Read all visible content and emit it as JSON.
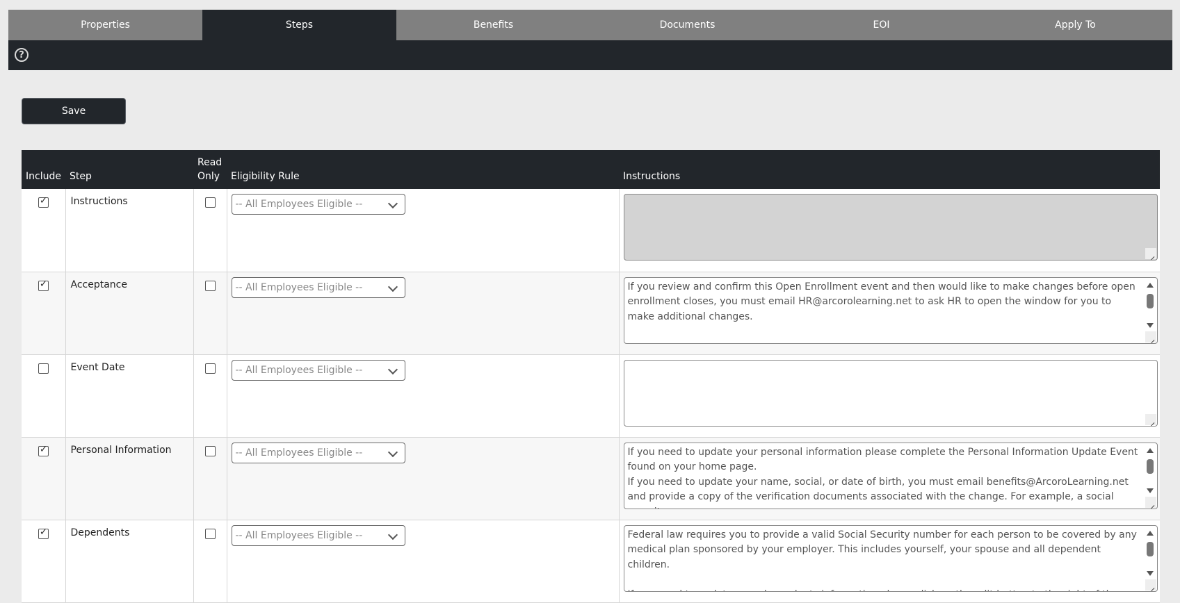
{
  "tabs": [
    "Properties",
    "Steps",
    "Benefits",
    "Documents",
    "EOI",
    "Apply To"
  ],
  "active_tab": "Steps",
  "help_icon": "question-circle-icon",
  "save_label": "Save",
  "table": {
    "headers": {
      "include": "Include",
      "step": "Step",
      "read_only": "Read Only",
      "eligibility_rule": "Eligibility Rule",
      "instructions": "Instructions"
    },
    "rows": [
      {
        "include": true,
        "step": "Instructions",
        "read_only": false,
        "eligibility_rule": "-- All Employees Eligible --",
        "instructions": "",
        "instructions_disabled": true,
        "scrollbar": false
      },
      {
        "include": true,
        "step": "Acceptance",
        "read_only": false,
        "eligibility_rule": "-- All Employees Eligible --",
        "instructions": "If you review and confirm this Open Enrollment event and then would like to make changes before open enrollment closes, you must email HR@arcorolearning.net to ask HR to open the window for you to make additional changes.",
        "instructions_disabled": false,
        "scrollbar": true
      },
      {
        "include": false,
        "step": "Event Date",
        "read_only": false,
        "eligibility_rule": "-- All Employees Eligible --",
        "instructions": "",
        "instructions_disabled": false,
        "scrollbar": false
      },
      {
        "include": true,
        "step": "Personal Information",
        "read_only": false,
        "eligibility_rule": "-- All Employees Eligible --",
        "instructions": "If you need to update your personal information please complete the Personal Information Update Event found on your home page.\nIf you need to update your name, social, or date of birth, you must email benefits@ArcoroLearning.net and provide a copy of the verification documents associated with the change. For example, a social security",
        "instructions_disabled": false,
        "scrollbar": true
      },
      {
        "include": true,
        "step": "Dependents",
        "read_only": false,
        "eligibility_rule": "-- All Employees Eligible --",
        "instructions": "Federal law requires you to provide a valid Social Security number for each person to be covered by any medical plan sponsored by your employer. This includes yourself, your spouse and all dependent children.\n\nIf you need to update your dependents information please click on the edit button to the right of the screen.",
        "instructions_disabled": false,
        "scrollbar": true
      }
    ]
  }
}
